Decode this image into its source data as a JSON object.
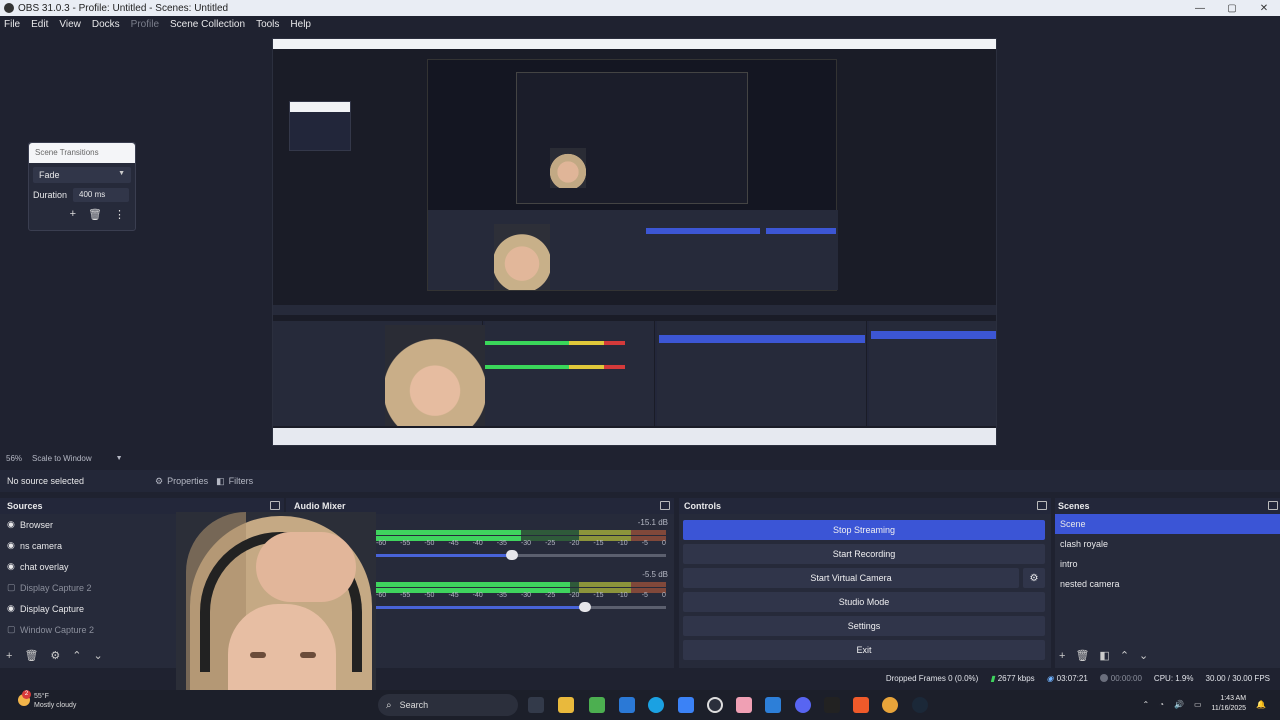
{
  "window": {
    "title": "OBS 31.0.3 - Profile: Untitled - Scenes: Untitled",
    "controls": [
      "—",
      "▢",
      "✕"
    ]
  },
  "menu": [
    {
      "label": "File",
      "enabled": true
    },
    {
      "label": "Edit",
      "enabled": true
    },
    {
      "label": "View",
      "enabled": true
    },
    {
      "label": "Docks",
      "enabled": true
    },
    {
      "label": "Profile",
      "enabled": false
    },
    {
      "label": "Scene Collection",
      "enabled": true
    },
    {
      "label": "Tools",
      "enabled": true
    },
    {
      "label": "Help",
      "enabled": true
    }
  ],
  "scene_transitions": {
    "title": "Scene Transitions",
    "transition": "Fade",
    "duration_label": "Duration",
    "duration_value": "400 ms"
  },
  "zoom": {
    "percent": "56%",
    "mode": "Scale to Window"
  },
  "context_bar": {
    "no_source": "No source selected",
    "properties": "Properties",
    "filters": "Filters"
  },
  "sources": {
    "title": "Sources",
    "items": [
      {
        "label": "Browser",
        "visible": true
      },
      {
        "label": "ns camera",
        "visible": true
      },
      {
        "label": "chat overlay",
        "visible": true
      },
      {
        "label": "Display Capture 2",
        "visible": false
      },
      {
        "label": "Display Capture",
        "visible": true
      },
      {
        "label": "Window Capture 2",
        "visible": false
      }
    ]
  },
  "audio_mixer": {
    "title": "Audio Mixer",
    "channels": [
      {
        "db": "-15.1 dB",
        "level": 0.5,
        "volume": 0.47
      },
      {
        "db": "-5.5 dB",
        "level": 0.67,
        "volume": 0.72
      }
    ],
    "ticks": [
      "-60",
      "-55",
      "-50",
      "-45",
      "-40",
      "-35",
      "-30",
      "-25",
      "-20",
      "-15",
      "-10",
      "-5",
      "0"
    ]
  },
  "controls": {
    "title": "Controls",
    "stop_streaming": "Stop Streaming",
    "start_recording": "Start Recording",
    "start_virtual_camera": "Start Virtual Camera",
    "studio_mode": "Studio Mode",
    "settings": "Settings",
    "exit": "Exit"
  },
  "scenes": {
    "title": "Scenes",
    "items": [
      {
        "label": "Scene",
        "active": true
      },
      {
        "label": "clash royale",
        "active": false
      },
      {
        "label": "intro",
        "active": false
      },
      {
        "label": "nested camera",
        "active": false
      }
    ]
  },
  "status": {
    "dropped_frames": "Dropped Frames 0 (0.0%)",
    "bitrate": "2677 kbps",
    "stream_time": "03:07:21",
    "rec_time": "00:00:00",
    "cpu": "CPU: 1.9%",
    "fps": "30.00 / 30.00 FPS"
  },
  "taskbar": {
    "weather_temp": "55°F",
    "weather_desc": "Mostly cloudy",
    "weather_badge": "2",
    "search_placeholder": "Search",
    "time": "1:43 AM",
    "date": "11/16/2025"
  },
  "colors": {
    "accent": "#3b55d6",
    "dock_bg": "#262a3a",
    "app_bg": "#1f2230",
    "meter_green": "#3fd45e",
    "meter_yellow": "#d9c53c",
    "meter_red": "#c33a3a"
  }
}
